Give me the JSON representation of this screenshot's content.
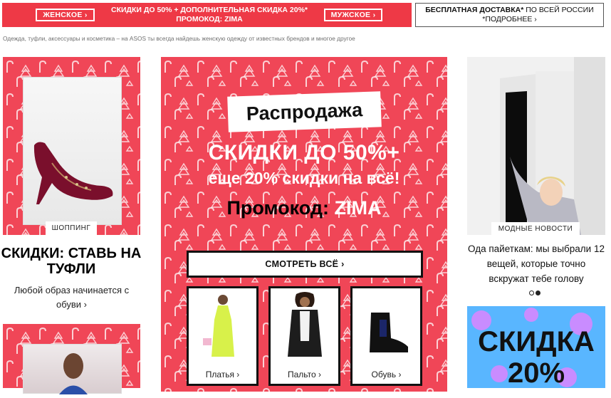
{
  "top_banner": {
    "women_button": "ЖЕНСКОЕ ›",
    "men_button": "МУЖСКОЕ ›",
    "line1": "СКИДКИ ДО 50% + ДОПОЛНИТЕЛЬНАЯ СКИДКА 20%*",
    "line2": "ПРОМОКОД: ZIMA",
    "delivery_bold": "БЕСПЛАТНАЯ ДОСТАВКА*",
    "delivery_rest": " ПО ВСЕЙ РОССИИ",
    "delivery_more": "*ПОДРОБНЕЕ ›"
  },
  "subtitle": "Одежда, туфли, аксессуары и косметика – на ASOS ты всегда найдешь женскую одежду от известных брендов и многое другое",
  "left": {
    "tag": "ШОППИНГ",
    "title": "СКИДКИ: СТАВЬ НА ТУФЛИ",
    "desc": "Любой образ начинается с обуви  ›"
  },
  "center": {
    "sale_label": "Распродажа",
    "line1": "СКИДКИ ДО 50%+",
    "line2": "еще 20% скидки на всё!",
    "promo_prefix": "Промокод: ",
    "promo_code": "ZIMA",
    "see_all": "СМОТРЕТЬ ВСЁ ›",
    "products": [
      {
        "label": "Платья ›"
      },
      {
        "label": "Пальто ›"
      },
      {
        "label": "Обувь ›"
      }
    ]
  },
  "right": {
    "tag": "МОДНЫЕ НОВОСТИ",
    "news": "Ода пайеткам: мы выбрали 12 вещей, которые точно вскружат тебе голову",
    "ad_text": "СКИДКА 20%"
  },
  "colors": {
    "banner_red": "#ee3946",
    "promo_red": "#f04657",
    "ad_blue": "#59b6ff"
  }
}
